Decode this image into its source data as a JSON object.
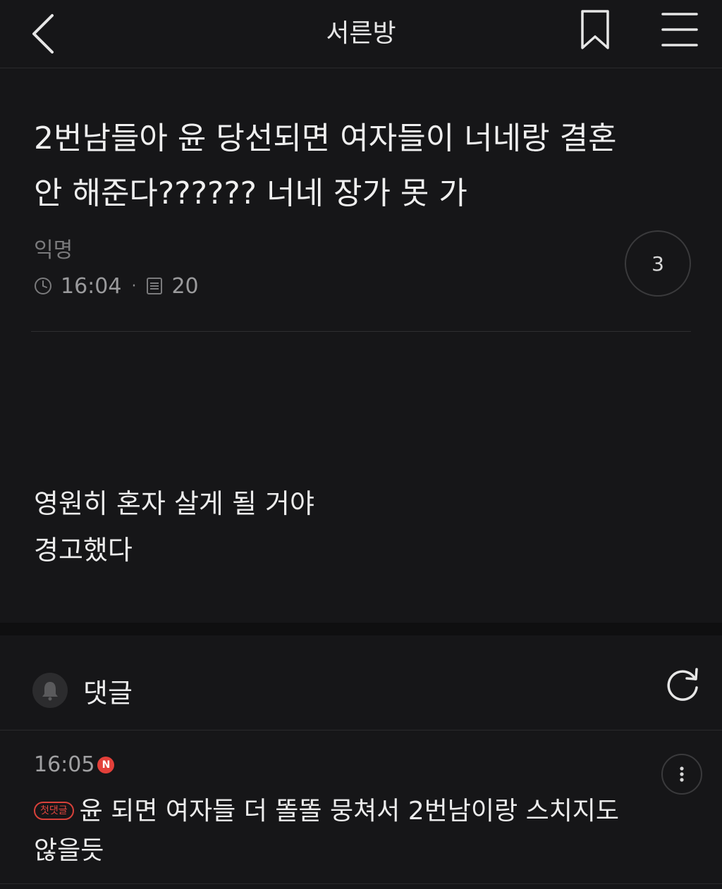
{
  "header": {
    "title": "서른방",
    "back_icon": "chevron-left-icon",
    "bookmark_icon": "bookmark-icon",
    "menu_icon": "hamburger-menu-icon"
  },
  "post": {
    "title_line1": "2번남들아 윤 당선되면 여자들이 너네랑 결혼",
    "title_line2": "안 해준다?????? 너네 장가 못 가",
    "author": "익명",
    "time": "16:04",
    "views": "20",
    "comment_count": "3",
    "body_line1": "영원히 혼자 살게 될 거야",
    "body_line2": "경고했다"
  },
  "comments_section": {
    "label": "댓글",
    "bell_icon": "bell-icon",
    "refresh_icon": "refresh-icon"
  },
  "comments": [
    {
      "time": "16:05",
      "new_badge": "N",
      "tag": "첫댓글",
      "text_line1": "윤 되면 여자들 더 똘똘 뭉쳐서 2번남이랑 스치지도",
      "text_line2": "않을듯"
    }
  ],
  "colors": {
    "background": "#161618",
    "accent_red": "#e3403a"
  }
}
